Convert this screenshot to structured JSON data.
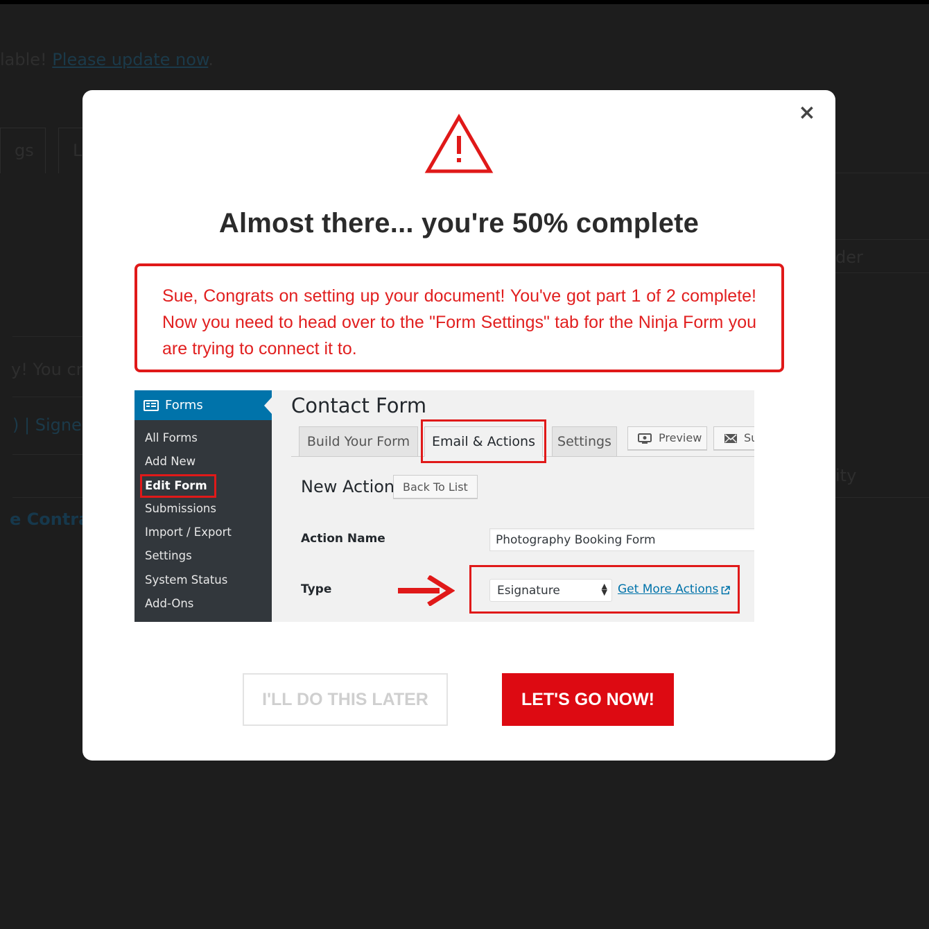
{
  "background": {
    "notice_prefix": "lable! ",
    "notice_link": "Please update now",
    "notice_suffix": ".",
    "tab_1": "gs",
    "tab_2": "L",
    "right_text_1": "der",
    "left_text_1": "y! You cr",
    "left_text_2": ")  |  Signe",
    "right_text_2": "ity",
    "left_text_3": "e Contra"
  },
  "modal": {
    "close_label": "×",
    "title": "Almost there... you're 50% complete",
    "message": "Sue, Congrats on setting up your document! You've got part 1 of 2 complete! Now you need to head over to the \"Form Settings\" tab for the Ninja Form you are trying to connect it to.",
    "screenshot": {
      "sidebar": {
        "header": "Forms",
        "items": [
          "All Forms",
          "Add New",
          "Edit Form",
          "Submissions",
          "Import / Export",
          "Settings",
          "System Status",
          "Add-Ons"
        ]
      },
      "page_title": "Contact Form",
      "tabs": [
        "Build Your Form",
        "Email & Actions",
        "Settings"
      ],
      "preview_button": "Preview",
      "submit_button": "Su",
      "new_action_title": "New Action",
      "back_to_list": "Back To List",
      "action_name_label": "Action Name",
      "action_name_value": "Photography Booking Form",
      "type_label": "Type",
      "type_value": "Esignature",
      "get_more_actions": "Get More Actions"
    },
    "later_button": "I'LL DO THIS LATER",
    "go_button": "LET'S GO NOW!"
  },
  "colors": {
    "accent_red": "#dd0a12",
    "message_red": "#e11f1f",
    "wp_blue": "#0073aa",
    "wp_sidebar": "#32373c",
    "overlay": "#1d1d1d"
  },
  "icons": [
    "warning-icon",
    "close-icon",
    "forms-icon",
    "preview-icon",
    "mail-icon",
    "arrow-right-icon",
    "external-link-icon",
    "select-arrows-icon"
  ]
}
